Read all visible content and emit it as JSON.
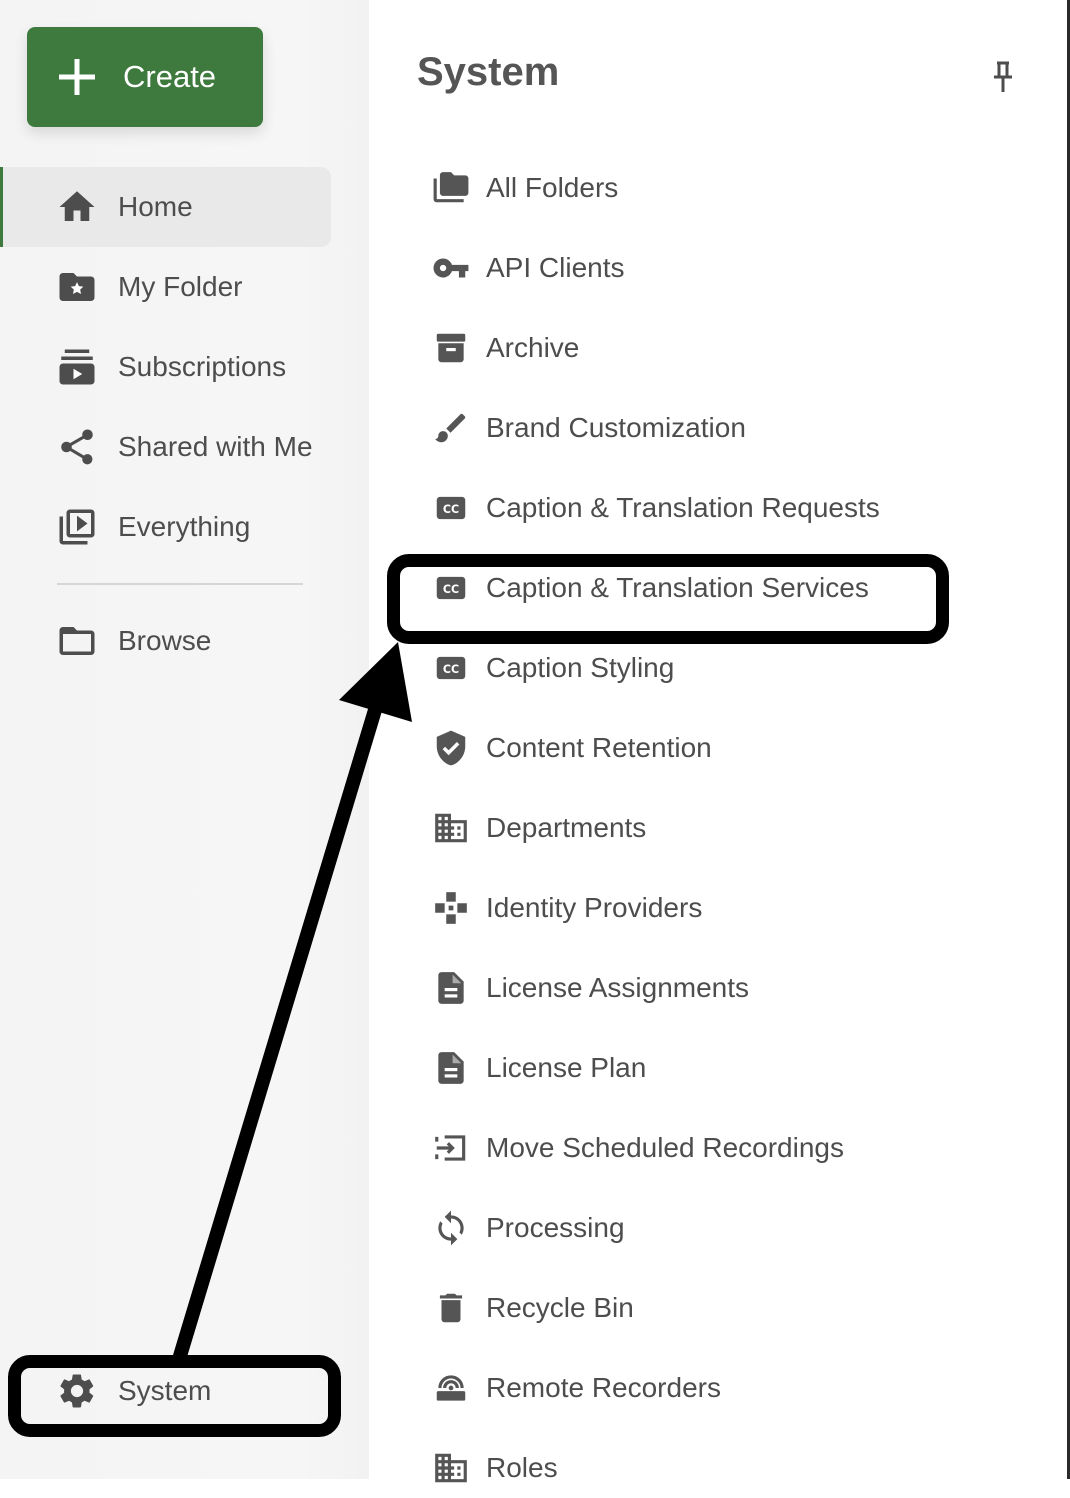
{
  "create_button": {
    "label": "Create",
    "icon": "plus-icon"
  },
  "nav": {
    "items": [
      {
        "label": "Home",
        "icon": "home-icon",
        "active": true
      },
      {
        "label": "My Folder",
        "icon": "folder-star-icon"
      },
      {
        "label": "Subscriptions",
        "icon": "subscriptions-icon"
      },
      {
        "label": "Shared with Me",
        "icon": "share-icon"
      },
      {
        "label": "Everything",
        "icon": "video-library-icon"
      }
    ],
    "browse": {
      "label": "Browse",
      "icon": "folder-outline-icon"
    },
    "system": {
      "label": "System",
      "icon": "gear-icon"
    }
  },
  "system_panel": {
    "title": "System",
    "pin_icon": "pin-icon",
    "items": [
      {
        "label": "All Folders",
        "icon": "folders-icon"
      },
      {
        "label": "API Clients",
        "icon": "key-icon"
      },
      {
        "label": "Archive",
        "icon": "archive-icon"
      },
      {
        "label": "Brand Customization",
        "icon": "brush-icon"
      },
      {
        "label": "Caption & Translation Requests",
        "icon": "closed-caption-icon"
      },
      {
        "label": "Caption & Translation Services",
        "icon": "closed-caption-icon",
        "highlighted": true
      },
      {
        "label": "Caption Styling",
        "icon": "closed-caption-icon"
      },
      {
        "label": "Content Retention",
        "icon": "shield-check-icon"
      },
      {
        "label": "Departments",
        "icon": "building-icon"
      },
      {
        "label": "Identity Providers",
        "icon": "connection-icon"
      },
      {
        "label": "License Assignments",
        "icon": "document-icon"
      },
      {
        "label": "License Plan",
        "icon": "document-icon"
      },
      {
        "label": "Move Scheduled Recordings",
        "icon": "move-icon"
      },
      {
        "label": "Processing",
        "icon": "sync-icon"
      },
      {
        "label": "Recycle Bin",
        "icon": "trash-icon"
      },
      {
        "label": "Remote Recorders",
        "icon": "recorder-icon"
      },
      {
        "label": "Roles",
        "icon": "building-icon"
      }
    ]
  },
  "colors": {
    "accent": "#3e7a3e",
    "annotation": "#000000",
    "icon": "#555555"
  }
}
